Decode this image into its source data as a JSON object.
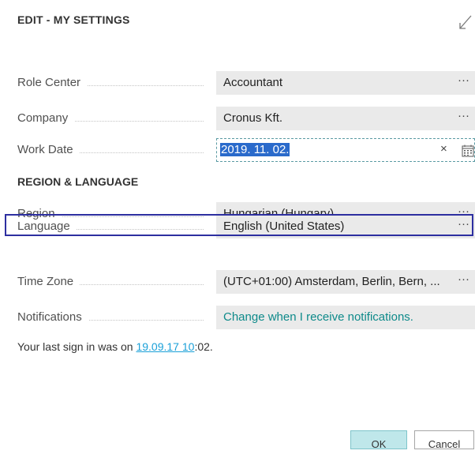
{
  "dialog": {
    "title": "EDIT - MY SETTINGS",
    "expand_icon": "expand-diagonal-icon"
  },
  "fields": {
    "role_center": {
      "label": "Role Center",
      "value": "Accountant",
      "more": "···"
    },
    "company": {
      "label": "Company",
      "value": "Cronus Kft.",
      "more": "···"
    },
    "work_date": {
      "label": "Work Date",
      "value": "2019. 11. 02.",
      "clear": "×",
      "calendar_icon": "calendar-icon"
    }
  },
  "region_section": {
    "title": "REGION & LANGUAGE",
    "region": {
      "label": "Region",
      "value": "Hungarian (Hungary)",
      "more": "···"
    },
    "language": {
      "label": "Language",
      "value": "English (United States)",
      "more": "···"
    },
    "time_zone": {
      "label": "Time Zone",
      "value": "(UTC+01:00) Amsterdam, Berlin, Bern, ...",
      "more": "···"
    },
    "notifications": {
      "label": "Notifications",
      "value": "Change when I receive notifications."
    }
  },
  "signin": {
    "prefix": "Your last sign in was on ",
    "link": "19.09.17 10",
    "suffix": ":02."
  },
  "buttons": {
    "ok": "OK",
    "cancel": "Cancel"
  },
  "colors": {
    "selection": "#2a6acb",
    "focus_outline": "#2d2fa0",
    "link": "#1aa0d8",
    "notification_link": "#0e8a8a",
    "ok_button": "#bfe7ea"
  }
}
